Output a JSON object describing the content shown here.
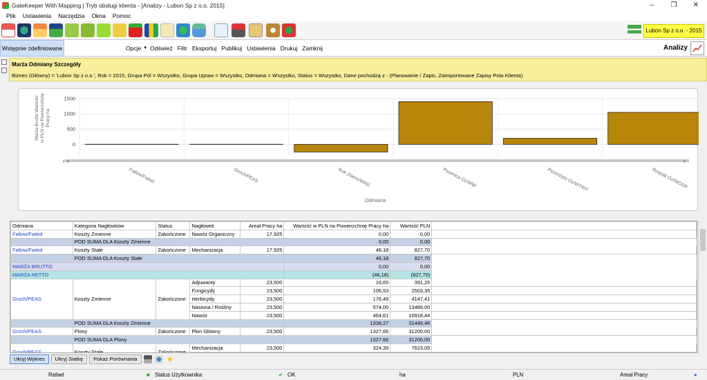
{
  "window": {
    "title": "GateKeeper With Mapping | Tryb obsługi klienta - [Analizy - Lubon Sp z o.o. 2015]"
  },
  "menu": [
    "Plik",
    "Ustawienia",
    "Narzędzia",
    "Okna",
    "Pomoc"
  ],
  "company": "Lubon Sp z o.o. - 2015",
  "preset": "Wstępnie zdefiniowane",
  "commands": {
    "opcje": "Opcje",
    "odswiez": "Odśwież",
    "filtr": "Filtr",
    "eksportuj": "Eksportuj",
    "publikuj": "Publikuj",
    "ustawienia": "Ustawienia",
    "drukuj": "Drukuj",
    "zamknij": "Zamknij"
  },
  "page_title": "Analizy",
  "report": {
    "title": "Marża Odmiany Szczegóły",
    "filter": "Biznes (Główny) = 'Lubon Sp z o.o.', Rok = 2015, Grupa Pól = Wszystko, Grupa Upraw = Wszystko, Odmiana = Wszystko, Status = Wszystko, Dane pochodzą z - (Planowanie / Zapis, Zaimportowane Zapisy Pola Klienta)"
  },
  "chart_data": {
    "type": "bar",
    "categories": [
      "Fallow/Failed",
      "Groch/PEAS",
      "Kuk Ziarno/MAIZ",
      "Pszenica Oz/WW",
      "Pszenżyto Oz/WTRIT",
      "Rzepak Oz/WOSR"
    ],
    "values": [
      0,
      0,
      -250,
      1400,
      200,
      1050
    ],
    "xlabel": "Odmiana",
    "ylabel": "Marża Brutto Wartość w PLN na Powierzchnię Pracy ha",
    "ylim": [
      -400,
      1500
    ],
    "yticks": [
      "1500",
      "1000",
      "500",
      "0",
      "-500"
    ],
    "colors": {
      "bar": "#b8860b"
    },
    "grid": true
  },
  "table": {
    "headers": [
      "Odmiana",
      "Kategoria Nagłówków",
      "Status",
      "Nagłówek",
      "Areał Pracy ha",
      "Wartość w PLN na Powierzchnię Pracy ha",
      "Wartość PLN"
    ],
    "fallow_var": {
      "odmiana": "Fallow/Failed",
      "kat": "Koszty Zmienne",
      "status": "Zakończone",
      "nagl": "Nawóz Organiczny",
      "areal": "17,925",
      "wpp": "0,00",
      "wpln": "0,00"
    },
    "fallow_var_sum": {
      "label": "POD SUMA DLA Koszty Zmienne",
      "wpp": "0,00",
      "wpln": "0,00"
    },
    "fallow_fix": {
      "odmiana": "Fallow/Failed",
      "kat": "Koszty Stałe",
      "status": "Zakończone",
      "nagl": "Mechanizacja",
      "areal": "17,925",
      "wpp": "46,18",
      "wpln": "827,70"
    },
    "fallow_fix_sum": {
      "label": "POD SUMA DLA Koszty Stałe",
      "wpp": "46,18",
      "wpln": "827,70"
    },
    "brutto": {
      "label": "MARŻA BRUTTO",
      "wpp": "0,00",
      "wpln": "0,00"
    },
    "netto": {
      "label": "MARŻA NETTO",
      "wpp": "(46,18)",
      "wpln": "(827,70)"
    },
    "groch_var": {
      "odmiana": "Groch/PEAS",
      "kat": "Koszty Zmienne",
      "status": "Zakończone",
      "rows": [
        {
          "nagl": "Adjuwanty",
          "areal": "23,500",
          "wpp": "16,65",
          "wpln": "391,25"
        },
        {
          "nagl": "Fungicydy",
          "areal": "23,500",
          "wpp": "106,53",
          "wpln": "2503,35"
        },
        {
          "nagl": "Herbicydy",
          "areal": "23,500",
          "wpp": "176,49",
          "wpln": "4147,41"
        },
        {
          "nagl": "Nasiona / Rośliny",
          "areal": "23,500",
          "wpp": "574,00",
          "wpln": "13489,00"
        },
        {
          "nagl": "Nawóz",
          "areal": "23,500",
          "wpp": "464,61",
          "wpln": "10918,44"
        }
      ]
    },
    "groch_var_sum": {
      "label": "POD SUMA DLA Koszty Zmienne",
      "wpp": "1338,27",
      "wpln": "31449,46"
    },
    "groch_plony": {
      "odmiana": "Groch/PEAS",
      "kat": "Plony",
      "status": "Zakończone",
      "nagl": "Plon Główny",
      "areal": "23,500",
      "wpp": "1327,66",
      "wpln": "31200,00"
    },
    "groch_plony_sum": {
      "label": "POD SUMA DLA Plony",
      "wpp": "1327,66",
      "wpln": "31200,00"
    },
    "groch_fix": {
      "odmiana": "Groch/PEAS",
      "kat": "Koszty Stałe",
      "status": "Zakończone",
      "nagl": "Mechanizacja",
      "areal": "23,500",
      "wpp": "324,39",
      "wpln": "7623,05"
    }
  },
  "buttons": {
    "hide_chart": "Ukryj Wykres",
    "hide_grid": "Ukryj Siatkę",
    "compare": "Pokaż Porównania"
  },
  "status": {
    "user": "Rafael",
    "user_status": "Status Użytkownika",
    "ok": "OK",
    "unit": "ha",
    "currency": "PLN",
    "areal": "Areał Pracy"
  }
}
